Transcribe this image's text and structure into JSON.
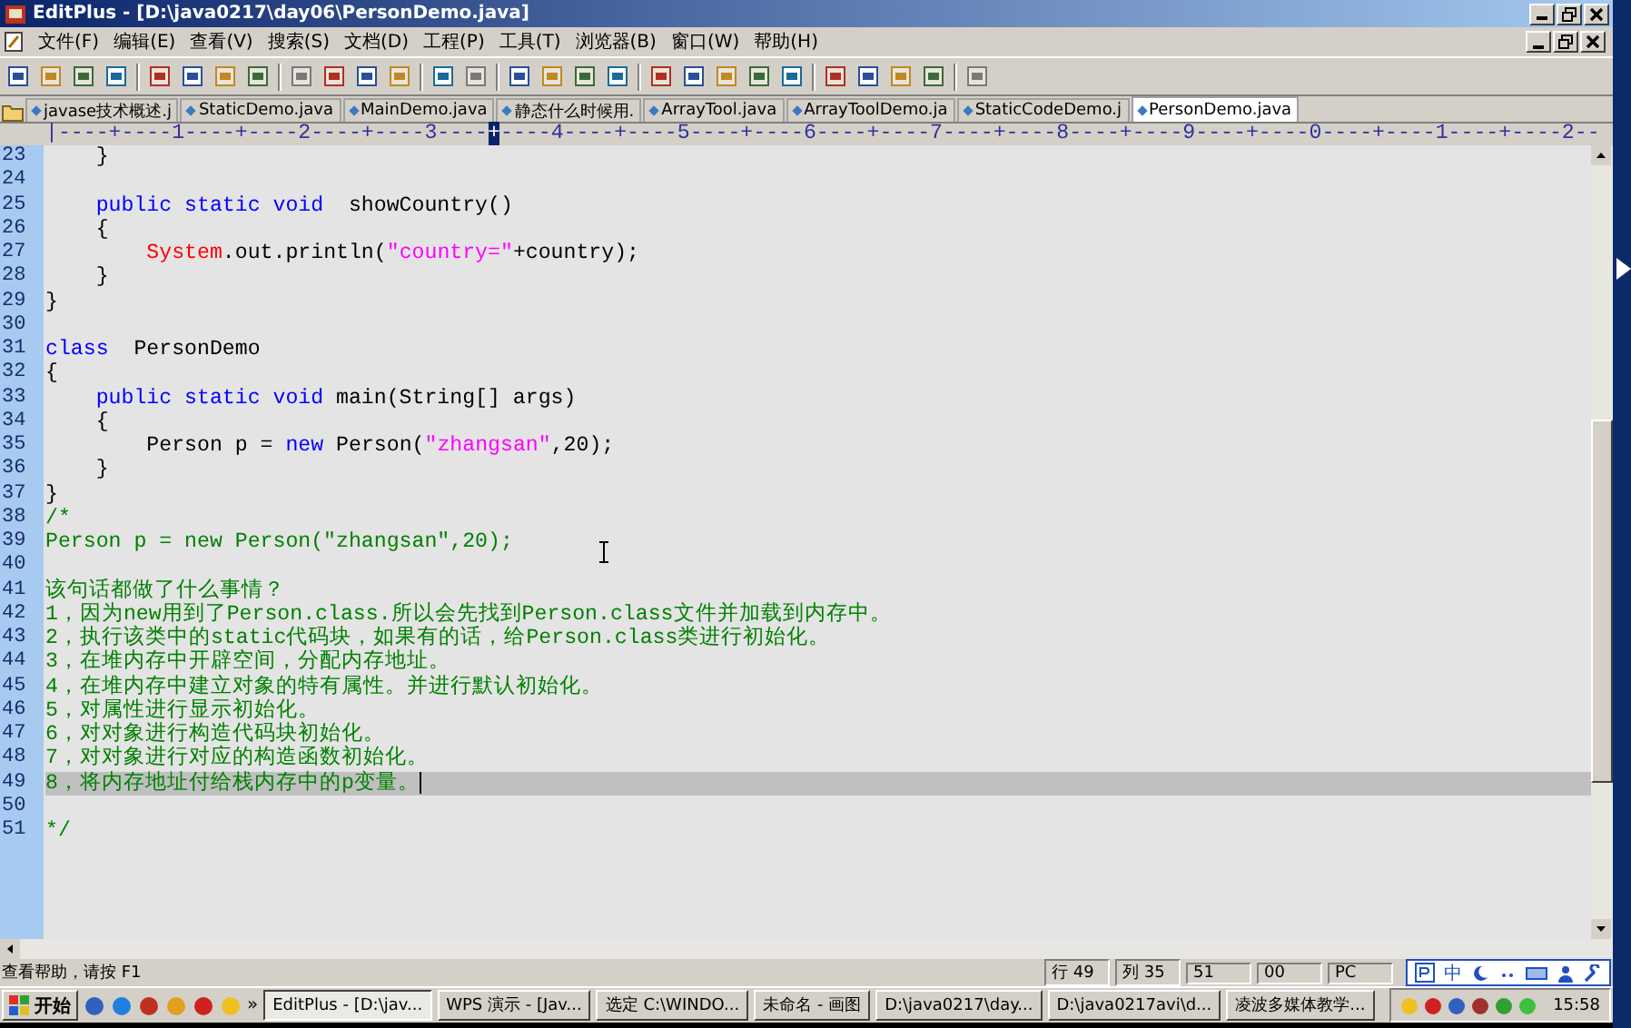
{
  "window": {
    "title": "EditPlus - [D:\\java0217\\day06\\PersonDemo.java]"
  },
  "menu": [
    "文件(F)",
    "编辑(E)",
    "查看(V)",
    "搜索(S)",
    "文档(D)",
    "工程(P)",
    "工具(T)",
    "浏览器(B)",
    "窗口(W)",
    "帮助(H)"
  ],
  "tabs": [
    {
      "label": "javase技术概述.j",
      "selected": false
    },
    {
      "label": "StaticDemo.java",
      "selected": false
    },
    {
      "label": "MainDemo.java",
      "selected": false
    },
    {
      "label": "静态什么时候用.",
      "selected": false
    },
    {
      "label": "ArrayTool.java",
      "selected": false
    },
    {
      "label": "ArrayToolDemo.ja",
      "selected": false
    },
    {
      "label": "StaticCodeDemo.j",
      "selected": false
    },
    {
      "label": "PersonDemo.java",
      "selected": true
    }
  ],
  "ruler": {
    "before": "|----+----1----+----2----+----3----",
    "marker": "+",
    "after": "----4----+----5----+----6----+----7----+----8----+----9----+----0----+----1----+----2--"
  },
  "lines": [
    {
      "number": "23",
      "current": false,
      "segments": [
        {
          "kind": "plain",
          "text": "    }"
        }
      ]
    },
    {
      "number": "24",
      "current": false
    },
    {
      "number": "25",
      "current": false,
      "segments": [
        {
          "kind": "keyword",
          "text": "    public static void"
        },
        {
          "kind": "plain",
          "text": "  showCountry()"
        }
      ]
    },
    {
      "number": "26",
      "current": false,
      "segments": [
        {
          "kind": "plain",
          "text": "    {"
        }
      ]
    },
    {
      "number": "27",
      "current": false,
      "segments": [
        {
          "kind": "class",
          "text": "        System"
        },
        {
          "kind": "plain",
          "text": ".out.println("
        },
        {
          "kind": "string",
          "text": "\"country=\""
        },
        {
          "kind": "plain",
          "text": "+country);"
        }
      ]
    },
    {
      "number": "28",
      "current": false,
      "segments": [
        {
          "kind": "plain",
          "text": "    }"
        }
      ]
    },
    {
      "number": "29",
      "current": false,
      "segments": [
        {
          "kind": "plain",
          "text": "}"
        }
      ]
    },
    {
      "number": "30",
      "current": false
    },
    {
      "number": "31",
      "current": false,
      "segments": [
        {
          "kind": "keyword",
          "text": "class"
        },
        {
          "kind": "plain",
          "text": "  PersonDemo"
        }
      ]
    },
    {
      "number": "32",
      "current": false,
      "segments": [
        {
          "kind": "plain",
          "text": "{"
        }
      ]
    },
    {
      "number": "33",
      "current": false,
      "segments": [
        {
          "kind": "keyword",
          "text": "    public static void"
        },
        {
          "kind": "plain",
          "text": " main(String[] args)"
        }
      ]
    },
    {
      "number": "34",
      "current": false,
      "segments": [
        {
          "kind": "plain",
          "text": "    {"
        }
      ]
    },
    {
      "number": "35",
      "current": false,
      "segments": [
        {
          "kind": "plain",
          "text": "        Person p = "
        },
        {
          "kind": "keyword",
          "text": "new"
        },
        {
          "kind": "plain",
          "text": " Person("
        },
        {
          "kind": "string",
          "text": "\"zhangsan\""
        },
        {
          "kind": "plain",
          "text": ",20);"
        }
      ]
    },
    {
      "number": "36",
      "current": false,
      "segments": [
        {
          "kind": "plain",
          "text": "    }"
        }
      ]
    },
    {
      "number": "37",
      "current": false,
      "segments": [
        {
          "kind": "plain",
          "text": "}"
        }
      ]
    },
    {
      "number": "38",
      "current": false,
      "segments": [
        {
          "kind": "comment",
          "text": "/*"
        }
      ]
    },
    {
      "number": "39",
      "current": false,
      "segments": [
        {
          "kind": "comment",
          "text": "Person p = new Person(\"zhangsan\",20);"
        }
      ]
    },
    {
      "number": "40",
      "current": false
    },
    {
      "number": "41",
      "current": false,
      "segments": [
        {
          "kind": "comment",
          "text": "该句话都做了什么事情？"
        }
      ]
    },
    {
      "number": "42",
      "current": false,
      "segments": [
        {
          "kind": "comment",
          "text": "1，因为new用到了Person.class.所以会先找到Person.class文件并加载到内存中。"
        }
      ]
    },
    {
      "number": "43",
      "current": false,
      "segments": [
        {
          "kind": "comment",
          "text": "2，执行该类中的static代码块，如果有的话，给Person.class类进行初始化。"
        }
      ]
    },
    {
      "number": "44",
      "current": false,
      "segments": [
        {
          "kind": "comment",
          "text": "3，在堆内存中开辟空间，分配内存地址。"
        }
      ]
    },
    {
      "number": "45",
      "current": false,
      "segments": [
        {
          "kind": "comment",
          "text": "4，在堆内存中建立对象的特有属性。并进行默认初始化。"
        }
      ]
    },
    {
      "number": "46",
      "current": false,
      "segments": [
        {
          "kind": "comment",
          "text": "5，对属性进行显示初始化。"
        }
      ]
    },
    {
      "number": "47",
      "current": false,
      "segments": [
        {
          "kind": "comment",
          "text": "6，对对象进行构造代码块初始化。"
        }
      ]
    },
    {
      "number": "48",
      "current": false,
      "segments": [
        {
          "kind": "comment",
          "text": "7，对对象进行对应的构造函数初始化。"
        }
      ]
    },
    {
      "number": "49",
      "current": true,
      "segments": [
        {
          "kind": "comment",
          "text": "8，将内存地址付给栈内存中的p变量。"
        }
      ]
    },
    {
      "number": "50",
      "current": false
    },
    {
      "number": "51",
      "current": false,
      "segments": [
        {
          "kind": "comment",
          "text": "*/"
        }
      ]
    }
  ],
  "status_bar": {
    "help": "查看帮助，请按 F1",
    "panels": [
      "行 49",
      "列 35",
      "51",
      "00",
      "PC"
    ]
  },
  "ime_bar": {
    "label": "中"
  },
  "taskbar": {
    "start": "开始",
    "more": "»",
    "tasks": [
      {
        "label": "EditPlus - [D:\\jav...",
        "selected": true
      },
      {
        "label": "WPS 演示 - [Jav...",
        "selected": false
      },
      {
        "label": "选定 C:\\WINDO...",
        "selected": false
      },
      {
        "label": "未命名 - 画图",
        "selected": false
      },
      {
        "label": "D:\\java0217\\day...",
        "selected": false
      },
      {
        "label": "D:\\java0217avi\\d...",
        "selected": false
      },
      {
        "label": "凌波多媒体教学...",
        "selected": false
      }
    ],
    "clock": "15:58"
  }
}
